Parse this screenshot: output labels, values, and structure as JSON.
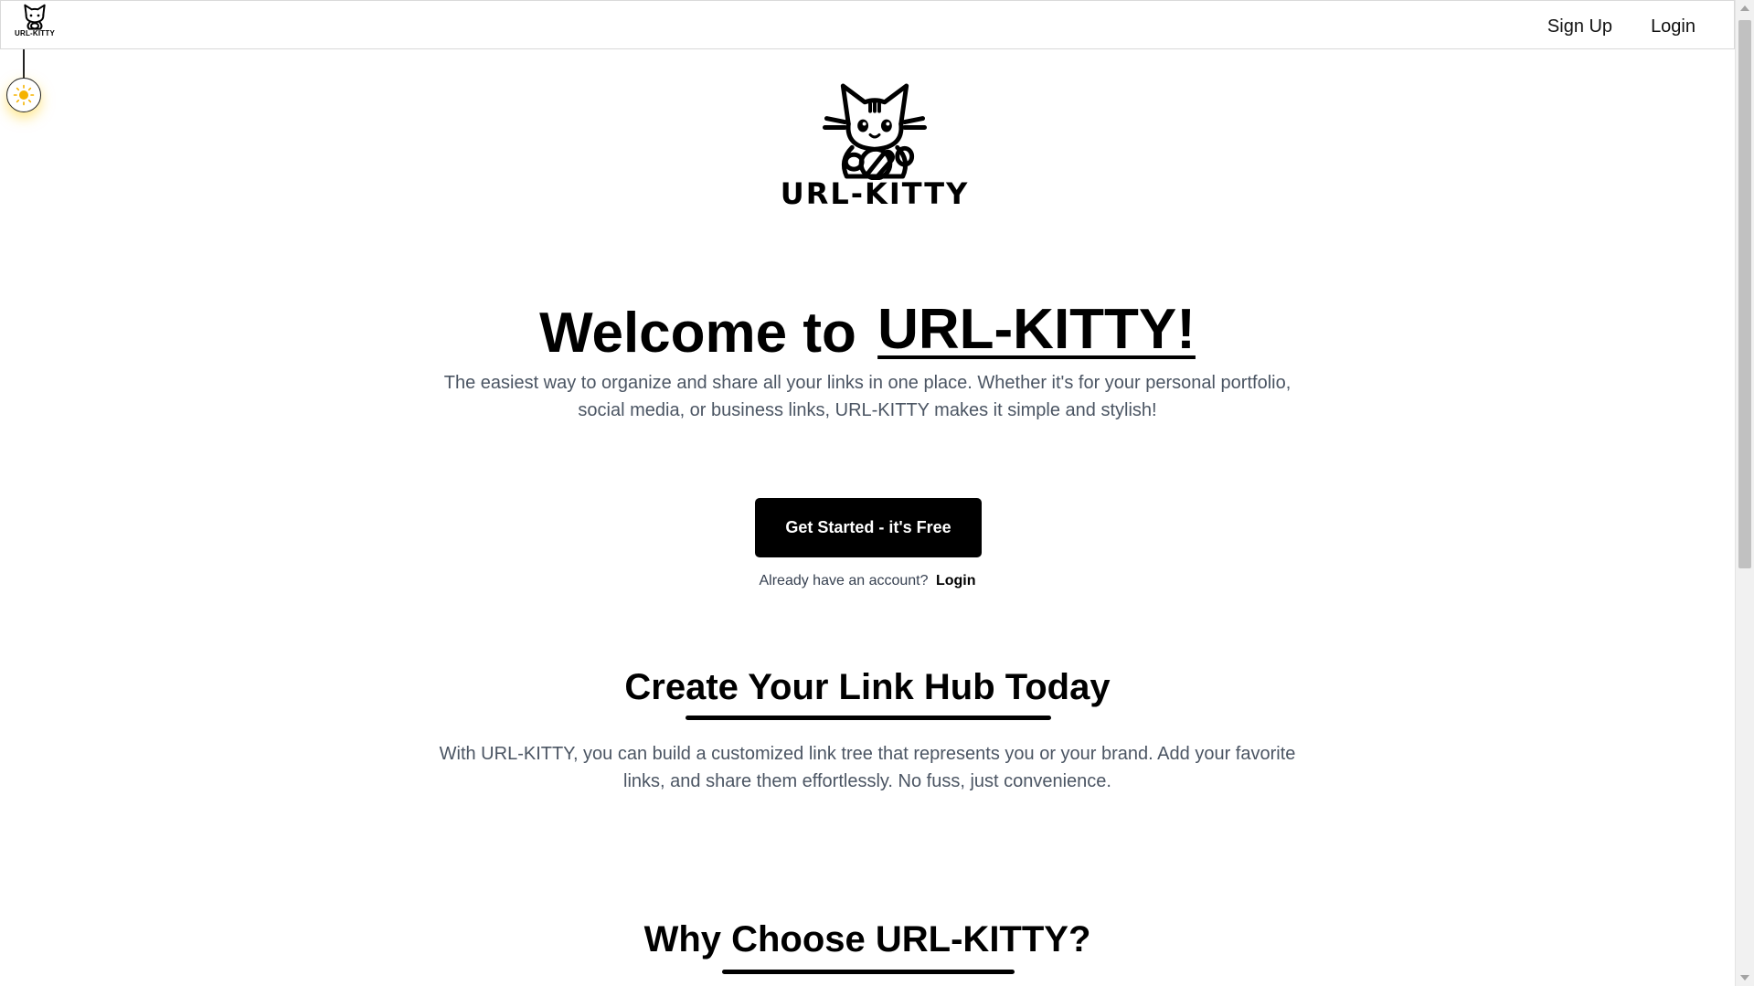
{
  "navbar": {
    "logo_text": "URL-KITTY",
    "links": [
      "Sign Up",
      "Login"
    ]
  },
  "theme_toggle": {
    "icon": "sun-icon",
    "accent_color": "#f5b301"
  },
  "hero": {
    "logo_text": "URL-KITTY",
    "welcome_prefix": "Welcome to",
    "welcome_brand": "URL-KITTY!",
    "description_line1": "The easiest way to organize and share all your links in one place. Whether it's for your personal portfolio,",
    "description_line2": "social media, or business links, URL-KITTY makes it simple and stylish!",
    "cta_label": "Get Started - it's Free",
    "already_text": "Already have an account?",
    "login_label": "Login"
  },
  "link_hub": {
    "title": "Create Your Link Hub Today",
    "description_line1": "With URL-KITTY, you can build a customized link tree that represents you or your brand. Add your favorite",
    "description_line2": "links, and share them effortlessly. No fuss, just convenience."
  },
  "why": {
    "title": "Why Choose URL-KITTY?"
  },
  "colors": {
    "text": "#000000",
    "muted_text": "#4b5563",
    "button_bg": "#000000",
    "button_text": "#ffffff"
  }
}
